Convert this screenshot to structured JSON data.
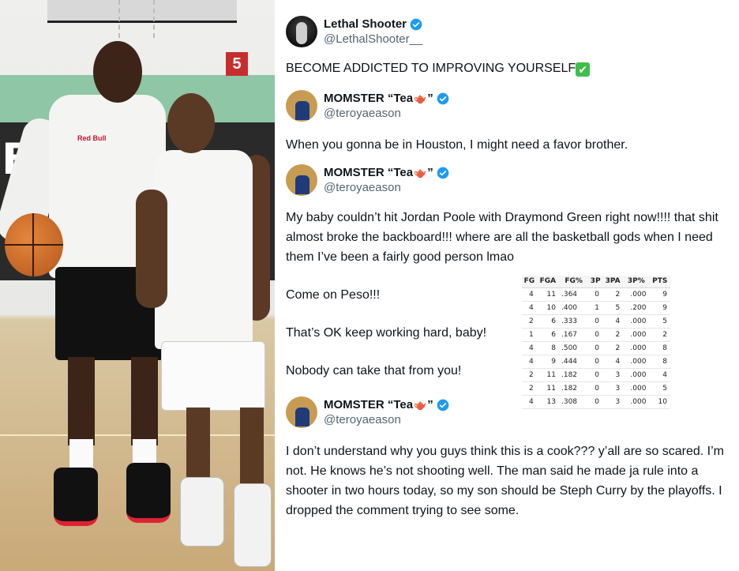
{
  "photo": {
    "wall_letters": "BA",
    "wall_number": "5",
    "shirt_logo": "Red Bull"
  },
  "tweets": [
    {
      "author_name": "Lethal Shooter",
      "handle": "@LethalShooter__",
      "verified": true,
      "text": "BECOME ADDICTED TO IMPROVING YOURSELF",
      "emoji": "✔"
    },
    {
      "author_name_prefix": "MOMSTER “Tea",
      "author_name_suffix": "”",
      "handle": "@teroyaeason",
      "verified": true,
      "text": "When you gonna be in Houston, I might need a favor brother."
    },
    {
      "author_name_prefix": "MOMSTER “Tea",
      "author_name_suffix": "”",
      "handle": "@teroyaeason",
      "verified": true,
      "text": "My baby couldn’t hit Jordan Poole with Draymond Green right now!!!! that shit almost broke the backboard!!! where are all the basketball gods when I need them I’ve been a fairly good person lmao",
      "lines": [
        "Come on Peso!!!",
        "That’s OK keep working hard, baby!",
        "Nobody can take that from you!"
      ]
    },
    {
      "author_name_prefix": "MOMSTER “Tea",
      "author_name_suffix": "”",
      "handle": "@teroyaeason",
      "verified": true,
      "text": "I don’t understand why you guys think this is a cook??? y’all are so scared. I’m not. He knows he’s not shooting well. The man said he made ja rule into a shooter in two hours today, so my son should be Steph Curry by the playoffs. I dropped the comment trying to see some."
    }
  ],
  "stats_table": {
    "headers": [
      "FG",
      "FGA",
      "FG%",
      "3P",
      "3PA",
      "3P%",
      "PTS"
    ],
    "rows": [
      [
        "4",
        "11",
        ".364",
        "0",
        "2",
        ".000",
        "9"
      ],
      [
        "4",
        "10",
        ".400",
        "1",
        "5",
        ".200",
        "9"
      ],
      [
        "2",
        "6",
        ".333",
        "0",
        "4",
        ".000",
        "5"
      ],
      [
        "1",
        "6",
        ".167",
        "0",
        "2",
        ".000",
        "2"
      ],
      [
        "4",
        "8",
        ".500",
        "0",
        "2",
        ".000",
        "8"
      ],
      [
        "4",
        "9",
        ".444",
        "0",
        "4",
        ".000",
        "8"
      ],
      [
        "2",
        "11",
        ".182",
        "0",
        "3",
        ".000",
        "4"
      ],
      [
        "2",
        "11",
        ".182",
        "0",
        "3",
        ".000",
        "5"
      ],
      [
        "4",
        "13",
        ".308",
        "0",
        "3",
        ".000",
        "10"
      ]
    ]
  },
  "colors": {
    "verified_blue": "#1d9bf0",
    "text_primary": "#0f1419",
    "text_secondary": "#536471",
    "check_green": "#3dbf4a"
  }
}
